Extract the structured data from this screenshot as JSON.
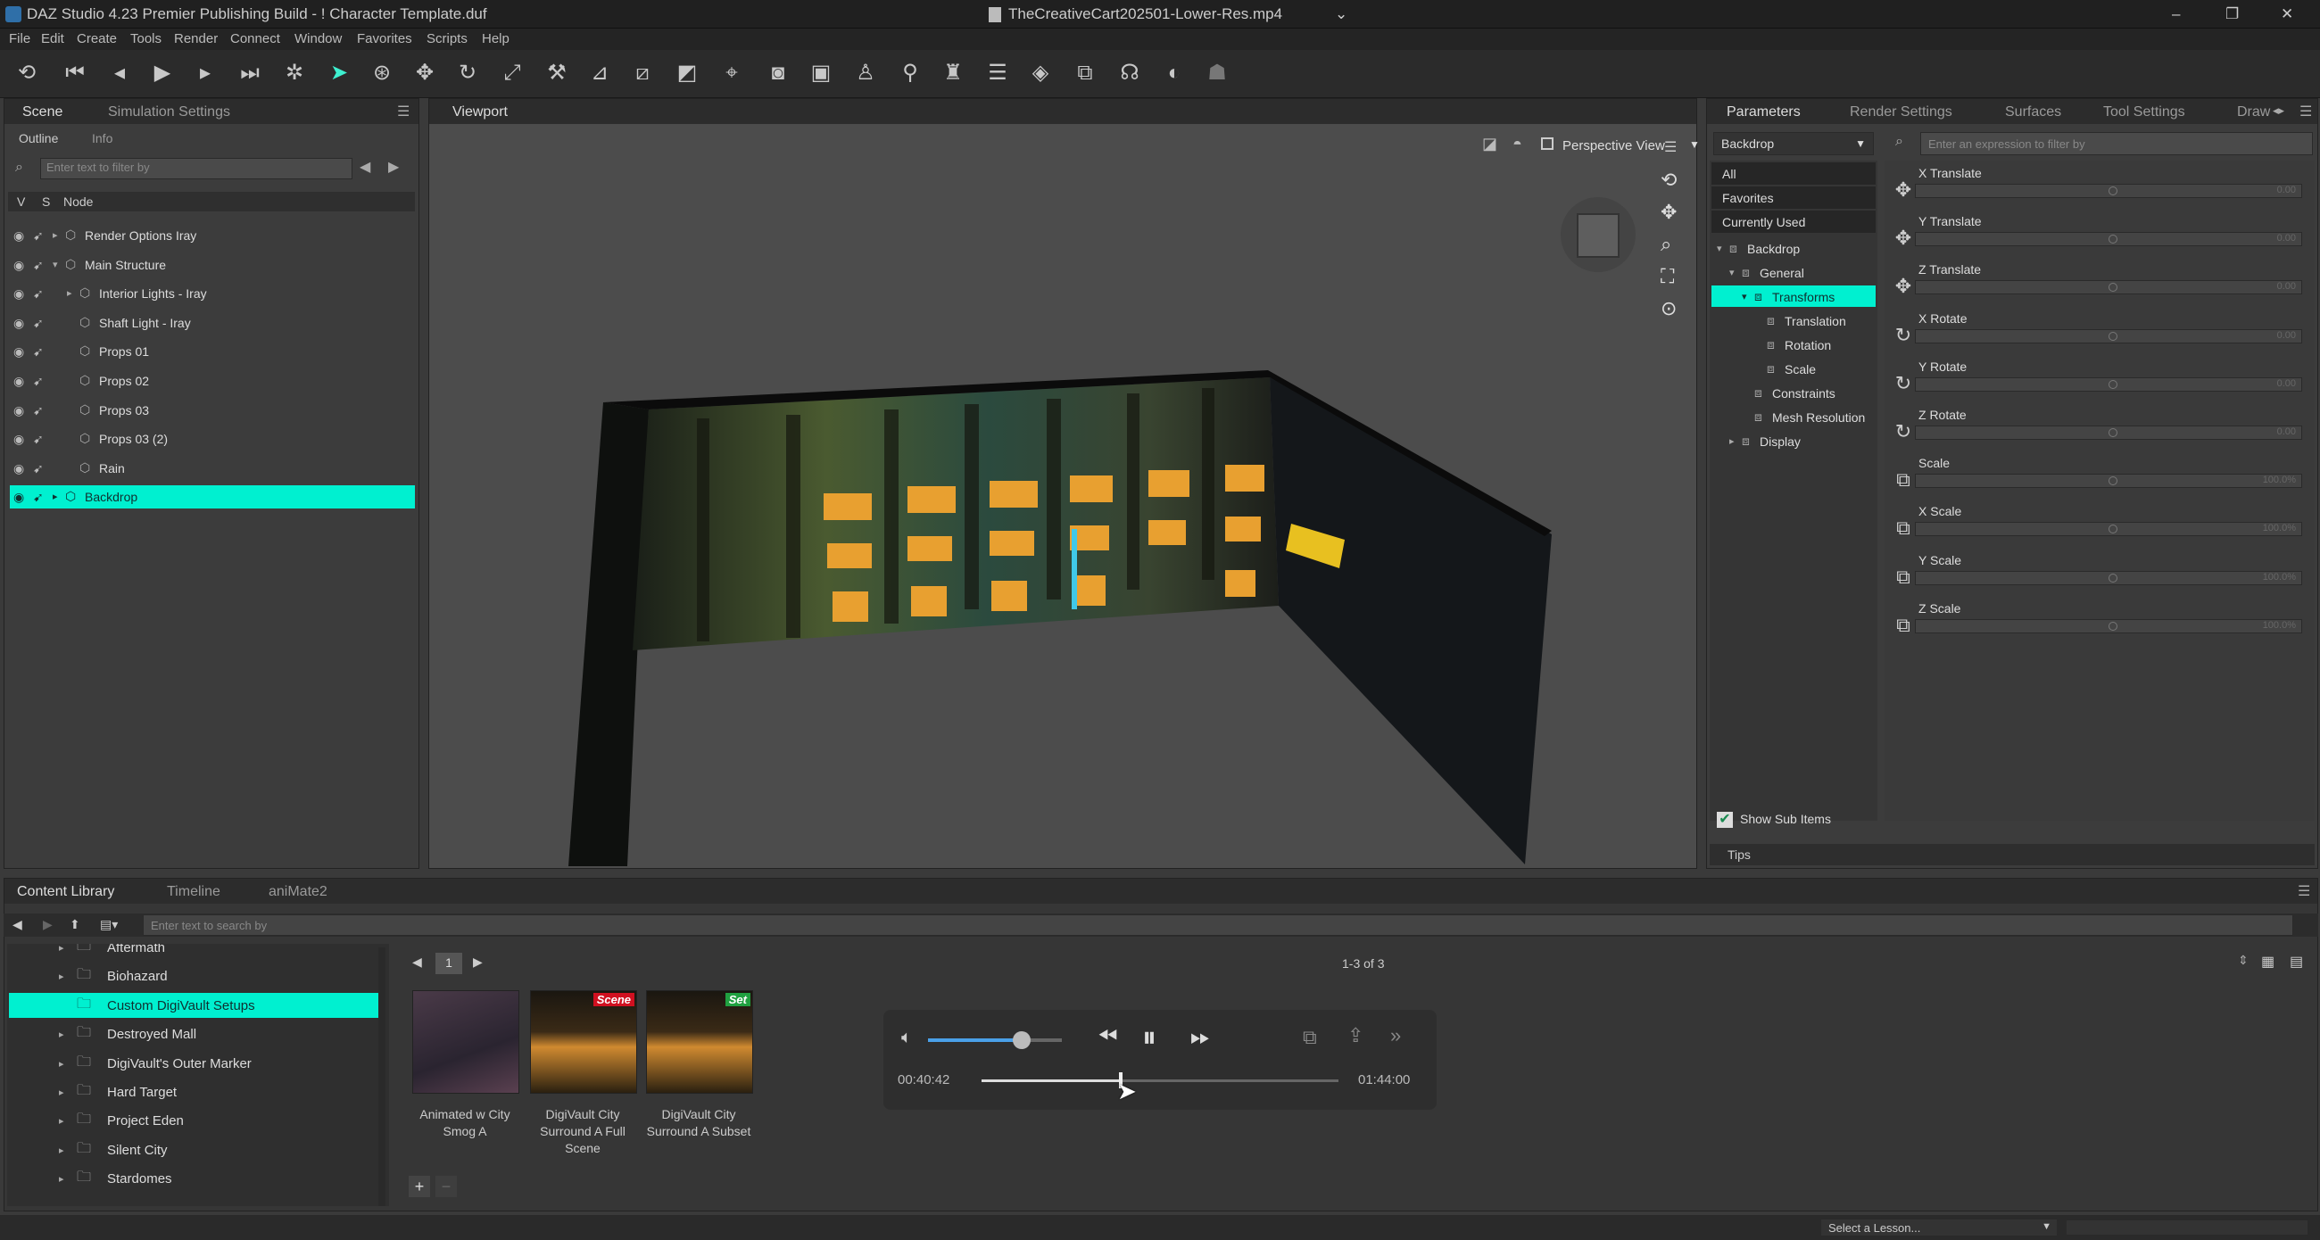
{
  "window": {
    "title": "DAZ Studio 4.23 Premier Publishing Build - ! Character Template.duf",
    "video_title": "TheCreativeCart202501-Lower-Res.mp4"
  },
  "menu": [
    "File",
    "Edit",
    "Create",
    "Tools",
    "Render",
    "Connect",
    "Window",
    "Favorites",
    "Scripts",
    "Help"
  ],
  "scene_panel": {
    "tabs": [
      "Scene",
      "Simulation Settings"
    ],
    "subtabs": [
      "Outline",
      "Info"
    ],
    "filter_placeholder": "Enter text to filter by",
    "columns": [
      "V",
      "S",
      "Node"
    ],
    "nodes": [
      {
        "label": "Render Options Iray",
        "indent": 0,
        "expand": "▸"
      },
      {
        "label": "Main Structure",
        "indent": 0,
        "expand": "▾"
      },
      {
        "label": "Interior Lights - Iray",
        "indent": 1,
        "expand": "▸"
      },
      {
        "label": "Shaft Light - Iray",
        "indent": 1,
        "expand": ""
      },
      {
        "label": "Props 01",
        "indent": 1,
        "expand": ""
      },
      {
        "label": "Props 02",
        "indent": 1,
        "expand": ""
      },
      {
        "label": "Props 03",
        "indent": 1,
        "expand": ""
      },
      {
        "label": "Props 03 (2)",
        "indent": 1,
        "expand": ""
      },
      {
        "label": "Rain",
        "indent": 1,
        "expand": ""
      },
      {
        "label": "Backdrop",
        "indent": 0,
        "expand": "▸",
        "selected": true
      }
    ]
  },
  "viewport": {
    "tab": "Viewport",
    "view": "Perspective View"
  },
  "params_panel": {
    "tabs": [
      "Parameters",
      "Render Settings",
      "Surfaces",
      "Tool Settings",
      "Draw"
    ],
    "node_select": "Backdrop",
    "filter_placeholder": "Enter an expression to filter by",
    "categories": [
      "All",
      "Favorites",
      "Currently Used"
    ],
    "tree": [
      {
        "label": "Backdrop",
        "level": 0,
        "expand": "▾"
      },
      {
        "label": "General",
        "level": 1,
        "expand": "▾"
      },
      {
        "label": "Transforms",
        "level": 2,
        "expand": "▾",
        "selected": true
      },
      {
        "label": "Translation",
        "level": 3,
        "expand": ""
      },
      {
        "label": "Rotation",
        "level": 3,
        "expand": ""
      },
      {
        "label": "Scale",
        "level": 3,
        "expand": ""
      },
      {
        "label": "Constraints",
        "level": 2,
        "expand": ""
      },
      {
        "label": "Mesh Resolution",
        "level": 2,
        "expand": ""
      },
      {
        "label": "Display",
        "level": 1,
        "expand": "▸"
      }
    ],
    "params": [
      {
        "label": "X Translate",
        "value": "0.00",
        "icon": "move-icon"
      },
      {
        "label": "Y Translate",
        "value": "0.00",
        "icon": "move-icon"
      },
      {
        "label": "Z Translate",
        "value": "0.00",
        "icon": "move-icon"
      },
      {
        "label": "X Rotate",
        "value": "0.00",
        "icon": "rotate-icon"
      },
      {
        "label": "Y Rotate",
        "value": "0.00",
        "icon": "rotate-icon"
      },
      {
        "label": "Z Rotate",
        "value": "0.00",
        "icon": "rotate-icon"
      },
      {
        "label": "Scale",
        "value": "100.0%",
        "icon": "scale-icon"
      },
      {
        "label": "X Scale",
        "value": "100.0%",
        "icon": "scale-icon"
      },
      {
        "label": "Y Scale",
        "value": "100.0%",
        "icon": "scale-icon"
      },
      {
        "label": "Z Scale",
        "value": "100.0%",
        "icon": "scale-icon"
      }
    ],
    "show_sub_items": "Show Sub Items",
    "tips": "Tips"
  },
  "content": {
    "tabs": [
      "Content Library",
      "Timeline",
      "aniMate2"
    ],
    "search_placeholder": "Enter text to search by",
    "folders": [
      {
        "label": "Aftermath",
        "selected": false
      },
      {
        "label": "Biohazard",
        "selected": false
      },
      {
        "label": "Custom DigiVault Setups",
        "selected": true
      },
      {
        "label": "Destroyed Mall",
        "selected": false
      },
      {
        "label": "DigiVault's Outer Marker",
        "selected": false
      },
      {
        "label": "Hard Target",
        "selected": false
      },
      {
        "label": "Project Eden",
        "selected": false
      },
      {
        "label": "Silent City",
        "selected": false
      },
      {
        "label": "Stardomes",
        "selected": false
      }
    ],
    "page": "1",
    "count": "1-3 of 3",
    "items": [
      {
        "caption": "Animated w City Smog A",
        "badge": ""
      },
      {
        "caption": "DigiVault City Surround A Full Scene",
        "badge": "Scene"
      },
      {
        "caption": "DigiVault City Surround A Subset",
        "badge": "Set"
      }
    ]
  },
  "player": {
    "current": "00:40:42",
    "total": "01:44:00",
    "progress": 0.39,
    "volume": 0.7
  },
  "statusbar": {
    "lesson": "Select a Lesson..."
  },
  "colors": {
    "accent": "#00f0d0",
    "badge_red": "#d01020",
    "badge_green": "#20a040"
  }
}
